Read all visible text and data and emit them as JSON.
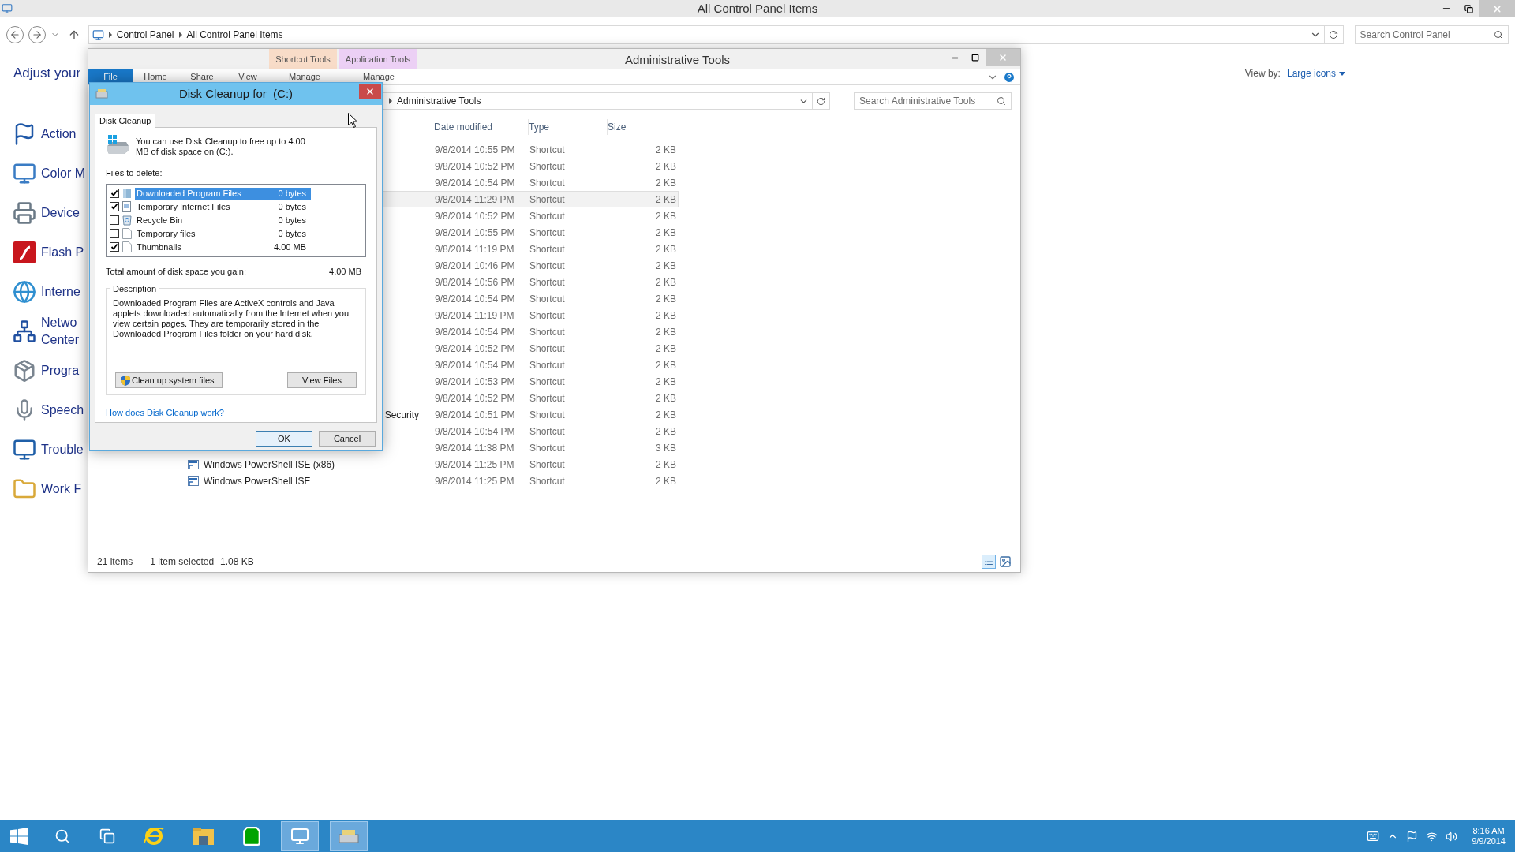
{
  "control_panel": {
    "title": "All Control Panel Items",
    "breadcrumb": [
      "Control Panel",
      "All Control Panel Items"
    ],
    "search_placeholder": "Search Control Panel",
    "heading": "Adjust your",
    "view_by": {
      "label": "View by:",
      "value": "Large icons"
    },
    "items": [
      {
        "lines": [
          "Action"
        ]
      },
      {
        "lines": [
          "Color M"
        ]
      },
      {
        "lines": [
          "Device"
        ]
      },
      {
        "lines": [
          "Flash P"
        ]
      },
      {
        "lines": [
          "Interne"
        ]
      },
      {
        "lines": [
          "Netwo",
          "Center"
        ]
      },
      {
        "lines": [
          "Progra"
        ]
      },
      {
        "lines": [
          "Speech"
        ]
      },
      {
        "lines": [
          "Trouble"
        ]
      },
      {
        "lines": [
          "Work F"
        ]
      }
    ]
  },
  "explorer": {
    "title": "Administrative Tools",
    "context_tabs": [
      {
        "label": "Shortcut Tools",
        "color": "#f8dcc8"
      },
      {
        "label": "Application Tools",
        "color": "#ecd0f5"
      }
    ],
    "ribbon_tabs": [
      {
        "label": "File",
        "kind": "file"
      },
      {
        "label": "Home",
        "kind": "tab"
      },
      {
        "label": "Share",
        "kind": "tab"
      },
      {
        "label": "View",
        "kind": "tab"
      },
      {
        "label": "Manage",
        "kind": "tab"
      },
      {
        "label": "Manage",
        "kind": "tab"
      }
    ],
    "address": "Administrative Tools",
    "search_placeholder": "Search Administrative Tools",
    "columns": [
      "Date modified",
      "Type",
      "Size"
    ],
    "rows": [
      {
        "date": "9/8/2014 10:55 PM",
        "type": "Shortcut",
        "size": "2 KB",
        "selected": false
      },
      {
        "date": "9/8/2014 10:52 PM",
        "type": "Shortcut",
        "size": "2 KB",
        "selected": false
      },
      {
        "date": "9/8/2014 10:54 PM",
        "type": "Shortcut",
        "size": "2 KB",
        "selected": false
      },
      {
        "date": "9/8/2014 11:29 PM",
        "type": "Shortcut",
        "size": "2 KB",
        "selected": true
      },
      {
        "date": "9/8/2014 10:52 PM",
        "type": "Shortcut",
        "size": "2 KB",
        "selected": false
      },
      {
        "date": "9/8/2014 10:55 PM",
        "type": "Shortcut",
        "size": "2 KB",
        "selected": false
      },
      {
        "date": "9/8/2014 11:19 PM",
        "type": "Shortcut",
        "size": "2 KB",
        "selected": false
      },
      {
        "date": "9/8/2014 10:46 PM",
        "type": "Shortcut",
        "size": "2 KB",
        "selected": false
      },
      {
        "date": "9/8/2014 10:56 PM",
        "type": "Shortcut",
        "size": "2 KB",
        "selected": false
      },
      {
        "date": "9/8/2014 10:54 PM",
        "type": "Shortcut",
        "size": "2 KB",
        "selected": false
      },
      {
        "date": "9/8/2014 11:19 PM",
        "type": "Shortcut",
        "size": "2 KB",
        "selected": false
      },
      {
        "date": "9/8/2014 10:54 PM",
        "type": "Shortcut",
        "size": "2 KB",
        "selected": false
      },
      {
        "date": "9/8/2014 10:52 PM",
        "type": "Shortcut",
        "size": "2 KB",
        "selected": false
      },
      {
        "date": "9/8/2014 10:54 PM",
        "type": "Shortcut",
        "size": "2 KB",
        "selected": false
      },
      {
        "date": "9/8/2014 10:53 PM",
        "type": "Shortcut",
        "size": "2 KB",
        "selected": false
      },
      {
        "date": "9/8/2014 10:52 PM",
        "type": "Shortcut",
        "size": "2 KB",
        "selected": false
      },
      {
        "name": "Security",
        "name_cut": true,
        "date": "9/8/2014 10:51 PM",
        "type": "Shortcut",
        "size": "2 KB",
        "selected": false
      },
      {
        "date": "9/8/2014 10:54 PM",
        "type": "Shortcut",
        "size": "2 KB",
        "selected": false
      },
      {
        "date": "9/8/2014 11:38 PM",
        "type": "Shortcut",
        "size": "3 KB",
        "selected": false
      },
      {
        "name": "Windows PowerShell ISE (x86)",
        "name_cut": false,
        "date": "9/8/2014 11:25 PM",
        "type": "Shortcut",
        "size": "2 KB",
        "selected": false
      },
      {
        "name": "Windows PowerShell ISE",
        "name_cut": false,
        "date": "9/8/2014 11:25 PM",
        "type": "Shortcut",
        "size": "2 KB",
        "selected": false
      }
    ],
    "status": {
      "count": "21 items",
      "selection": "1 item selected",
      "size": "1.08 KB"
    }
  },
  "dialog": {
    "title": "Disk Cleanup for  (C:)",
    "tab": "Disk Cleanup",
    "intro": "You can use Disk Cleanup to free up to 4.00 MB of disk space on  (C:).",
    "files_label": "Files to delete:",
    "files": [
      {
        "label": "Downloaded Program Files",
        "size": "0 bytes",
        "checked": true,
        "selected": true
      },
      {
        "label": "Temporary Internet Files",
        "size": "0 bytes",
        "checked": true,
        "selected": false
      },
      {
        "label": "Recycle Bin",
        "size": "0 bytes",
        "checked": false,
        "selected": false
      },
      {
        "label": "Temporary files",
        "size": "0 bytes",
        "checked": false,
        "selected": false
      },
      {
        "label": "Thumbnails",
        "size": "4.00 MB",
        "checked": true,
        "selected": false
      }
    ],
    "total_label": "Total amount of disk space you gain:",
    "total_value": "4.00 MB",
    "description_title": "Description",
    "description": "Downloaded Program Files are ActiveX controls and Java applets downloaded automatically from the Internet when you view certain pages. They are temporarily stored in the Downloaded Program Files folder on your hard disk.",
    "cleanup_button": "Clean up system files",
    "view_button": "View Files",
    "help_link": "How does Disk Cleanup work?",
    "ok": "OK",
    "cancel": "Cancel"
  },
  "taskbar": {
    "apps": [
      {
        "open": false
      },
      {
        "open": false
      },
      {
        "open": false
      },
      {
        "open": false
      },
      {
        "open": false
      },
      {
        "open": false
      },
      {
        "open": true
      },
      {
        "open": true
      }
    ],
    "time": "8:16 AM",
    "date": "9/9/2014"
  }
}
